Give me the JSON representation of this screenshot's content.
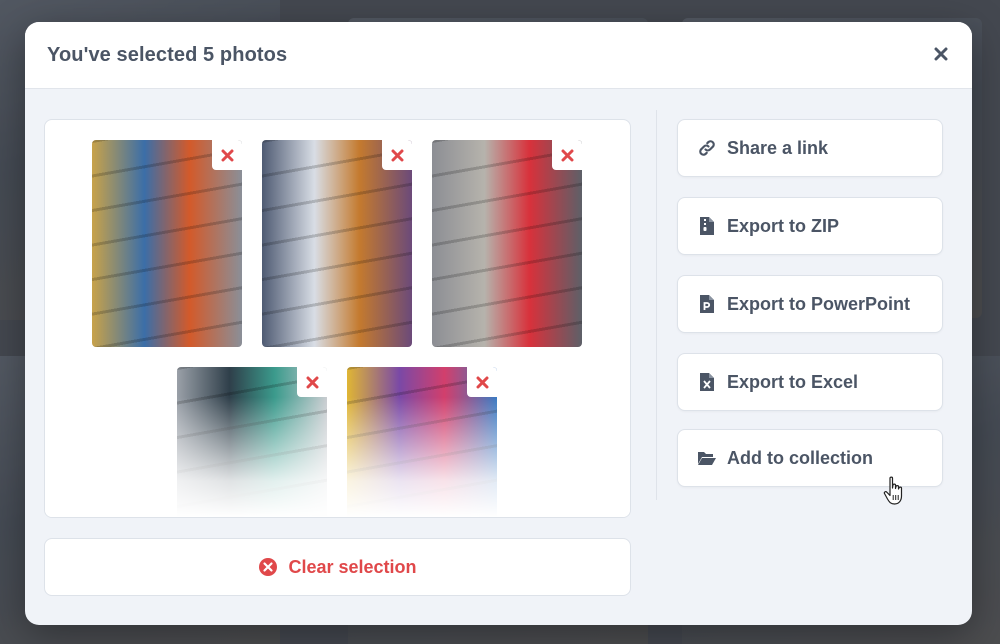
{
  "modal": {
    "title": "You've selected 5 photos"
  },
  "photos": [
    {
      "name": "photo-1",
      "colors": [
        "#c8a24a",
        "#3b6ea8",
        "#d35a2a",
        "#8a8f98"
      ]
    },
    {
      "name": "photo-2",
      "colors": [
        "#4f5b73",
        "#d8dde5",
        "#c47a2e",
        "#6b4a7a"
      ]
    },
    {
      "name": "photo-3",
      "colors": [
        "#8c8e94",
        "#b6b3ac",
        "#d8313b",
        "#5d6068"
      ]
    },
    {
      "name": "photo-4",
      "colors": [
        "#9aa0a8",
        "#2f3f4a",
        "#3b9a8c",
        "#c9ccd0"
      ]
    },
    {
      "name": "photo-5",
      "colors": [
        "#e0b634",
        "#7a49a6",
        "#d23f6c",
        "#3a7ac2"
      ]
    }
  ],
  "actions": [
    {
      "label": "Share a link",
      "icon": "link-icon"
    },
    {
      "label": "Export to ZIP",
      "icon": "file-zip-icon"
    },
    {
      "label": "Export to PowerPoint",
      "icon": "file-powerpoint-icon"
    },
    {
      "label": "Export to Excel",
      "icon": "file-excel-icon"
    },
    {
      "label": "Add to collection",
      "icon": "folder-open-icon"
    }
  ],
  "clear": {
    "label": "Clear selection",
    "icon": "x-circle-icon"
  },
  "colors": {
    "accent_red": "#e0484a",
    "text": "#4b5565",
    "modal_bg": "#f0f3f8"
  }
}
